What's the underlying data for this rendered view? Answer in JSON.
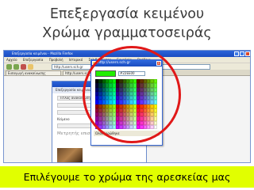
{
  "slide": {
    "title_line1": "Επεξεργασία κειμένου",
    "title_line2": "Χρώμα γραμματοσειράς",
    "caption": "Επιλέγουμε το χρώμα της αρεσκείας μας"
  },
  "browser": {
    "window_title": "Επεξεργασία κειμένου - Mozilla Firefox",
    "menu": [
      "Αρχείο",
      "Επεξεργασία",
      "Προβολή",
      "Ιστορικό",
      "Σελιδοδείκτες",
      "Εργαλεία",
      "Βοήθεια"
    ],
    "url": "http://users.sch.gr",
    "tabs": [
      "Εισαγωγή ανακοίνωσης",
      "http://users.sch.gr/..."
    ]
  },
  "editor_popup": {
    "header": "Επεξεργασία κειμένου",
    "title_field": "Τίτλος ανακοίνωσης",
    "label": "Κείμενο",
    "body_text": "Μετρητής επισκεψεων"
  },
  "color_picker": {
    "window_title": "http://users.sch.gr",
    "hex_value": "#22EE00",
    "status": "Ολοκληρώθηκε",
    "selected_color": "#22ee00"
  },
  "colors": {
    "caption_bg": "#e1ff00",
    "highlight": "#e01818"
  }
}
